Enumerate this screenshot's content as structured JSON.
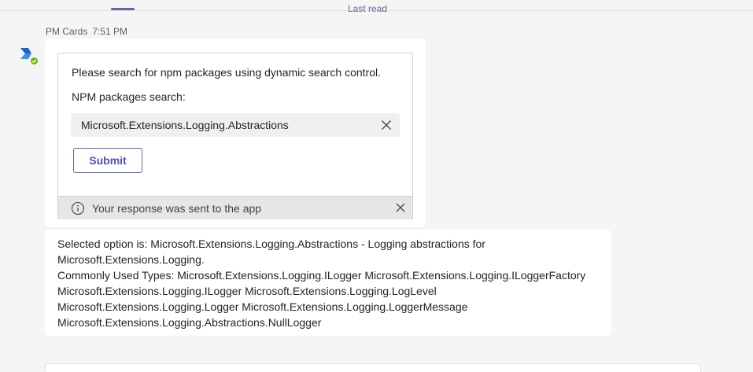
{
  "header": {
    "last_read": "Last read"
  },
  "message": {
    "sender": "PM Cards",
    "time": "7:51 PM",
    "avatar_icon": "bot-app-icon",
    "presence": "available"
  },
  "card": {
    "prompt": "Please search for npm packages using dynamic search control.",
    "search_label": "NPM packages search:",
    "search_value": "Microsoft.Extensions.Logging.Abstractions",
    "submit_label": "Submit",
    "status_text": "Your response was sent to the app"
  },
  "reply": {
    "lines": [
      "Selected option is: Microsoft.Extensions.Logging.Abstractions - Logging abstractions for",
      "Microsoft.Extensions.Logging.",
      "Commonly Used Types: Microsoft.Extensions.Logging.ILogger Microsoft.Extensions.Logging.ILoggerFactory",
      "Microsoft.Extensions.Logging.ILogger Microsoft.Extensions.Logging.LogLevel",
      "Microsoft.Extensions.Logging.Logger Microsoft.Extensions.Logging.LoggerMessage",
      "Microsoft.Extensions.Logging.Abstractions.NullLogger"
    ]
  },
  "colors": {
    "accent": "#6264a7",
    "presence": "#6bb700",
    "app_icon": "#2d6fd6"
  }
}
